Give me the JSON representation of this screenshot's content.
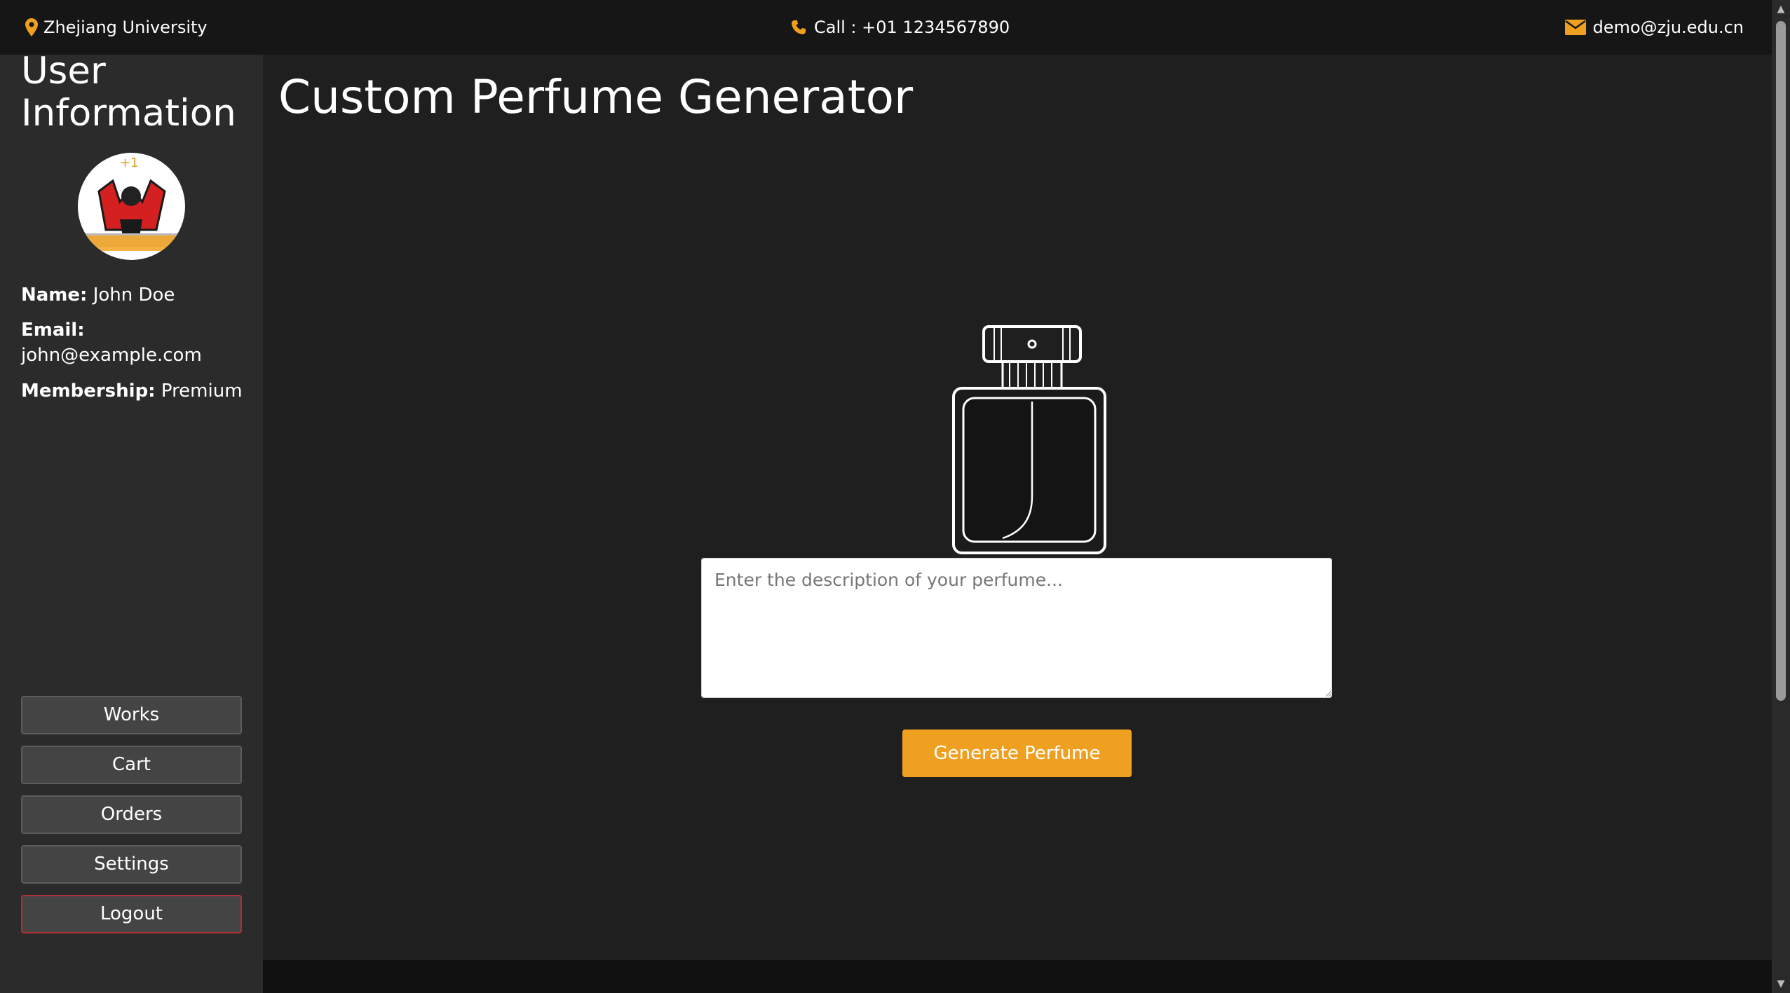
{
  "header": {
    "location": "Zhejiang University",
    "call": "Call : +01 1234567890",
    "email": "demo@zju.edu.cn"
  },
  "sidebar": {
    "title": "User Information",
    "user": {
      "name_label": "Name:",
      "name": "John Doe",
      "email_label": "Email:",
      "email": "john@example.com",
      "membership_label": "Membership:",
      "membership": "Premium"
    },
    "buttons": {
      "works": "Works",
      "cart": "Cart",
      "orders": "Orders",
      "settings": "Settings",
      "logout": "Logout"
    }
  },
  "main": {
    "title": "Custom Perfume Generator",
    "description": {
      "placeholder": "Enter the description of your perfume...",
      "value": ""
    },
    "generate_label": "Generate Perfume"
  },
  "colors": {
    "accent": "#f0a020",
    "background": "#1f1f1f",
    "sidebar": "#2b2b2b",
    "topbar": "#161616",
    "logout_border": "#b0303a"
  },
  "icons": {
    "location": "map-pin-icon",
    "phone": "phone-icon",
    "email": "envelope-icon"
  }
}
